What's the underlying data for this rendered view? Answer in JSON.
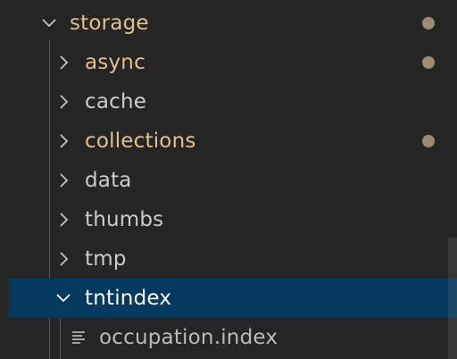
{
  "explorer": {
    "items": [
      {
        "label": "storage",
        "type": "folder",
        "expanded": true,
        "depth": 0,
        "modified": true
      },
      {
        "label": "async",
        "type": "folder",
        "expanded": false,
        "depth": 1,
        "modified": true
      },
      {
        "label": "cache",
        "type": "folder",
        "expanded": false,
        "depth": 1,
        "modified": false
      },
      {
        "label": "collections",
        "type": "folder",
        "expanded": false,
        "depth": 1,
        "modified": true
      },
      {
        "label": "data",
        "type": "folder",
        "expanded": false,
        "depth": 1,
        "modified": false
      },
      {
        "label": "thumbs",
        "type": "folder",
        "expanded": false,
        "depth": 1,
        "modified": false
      },
      {
        "label": "tmp",
        "type": "folder",
        "expanded": false,
        "depth": 1,
        "modified": false
      },
      {
        "label": "tntindex",
        "type": "folder",
        "expanded": true,
        "depth": 1,
        "modified": false,
        "selected": true
      },
      {
        "label": "occupation.index",
        "type": "file",
        "depth": 2,
        "icon": "file-lines-icon"
      }
    ]
  },
  "colors": {
    "background": "#252526",
    "selection": "#04395e",
    "modified_text": "#e2c08d",
    "modified_dot": "#9e8c70",
    "default_text": "#cccccc"
  }
}
